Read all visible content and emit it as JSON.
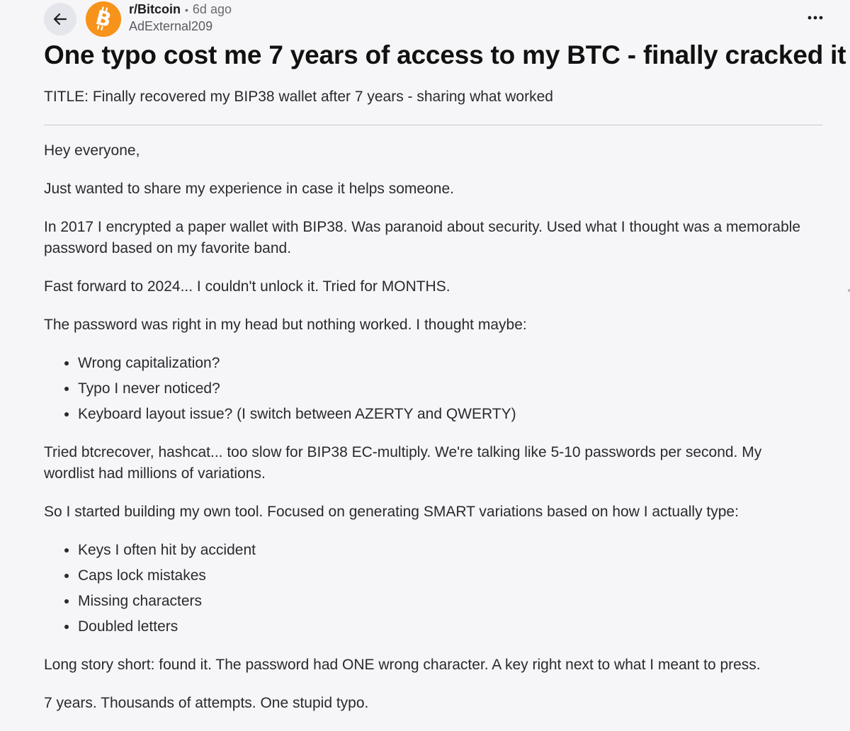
{
  "header": {
    "subreddit": "r/Bitcoin",
    "separator": "•",
    "age": "6d ago",
    "author": "AdExternal209",
    "back_icon": "arrow-left-icon",
    "avatar_icon": "bitcoin-logo",
    "avatar_color": "#f7931a",
    "more_icon": "ellipsis-icon"
  },
  "post": {
    "title": "One typo cost me 7 years of access to my BTC - finally cracked it",
    "subtitle": "TITLE: Finally recovered my BIP38 wallet after 7 years - sharing what worked",
    "p1": "Hey everyone,",
    "p2": "Just wanted to share my experience in case it helps someone.",
    "p3": "In 2017 I encrypted a paper wallet with BIP38. Was paranoid about security. Used what I thought was a memorable password based on my favorite band.",
    "p4": "Fast forward to 2024... I couldn't unlock it. Tried for MONTHS.",
    "p5": "The password was right in my head but nothing worked. I thought maybe:",
    "list1": [
      "Wrong capitalization?",
      "Typo I never noticed?",
      "Keyboard layout issue? (I switch between AZERTY and QWERTY)"
    ],
    "p6": "Tried btcrecover, hashcat... too slow for BIP38 EC-multiply. We're talking like 5-10 passwords per second. My wordlist had millions of variations.",
    "p7": "So I started building my own tool. Focused on generating SMART variations based on how I actually type:",
    "list2": [
      "Keys I often hit by accident",
      "Caps lock mistakes",
      "Missing characters",
      "Doubled letters"
    ],
    "p8": "Long story short: found it. The password had ONE wrong character. A key right next to what I meant to press.",
    "p9": "7 years. Thousands of attempts. One stupid typo."
  }
}
